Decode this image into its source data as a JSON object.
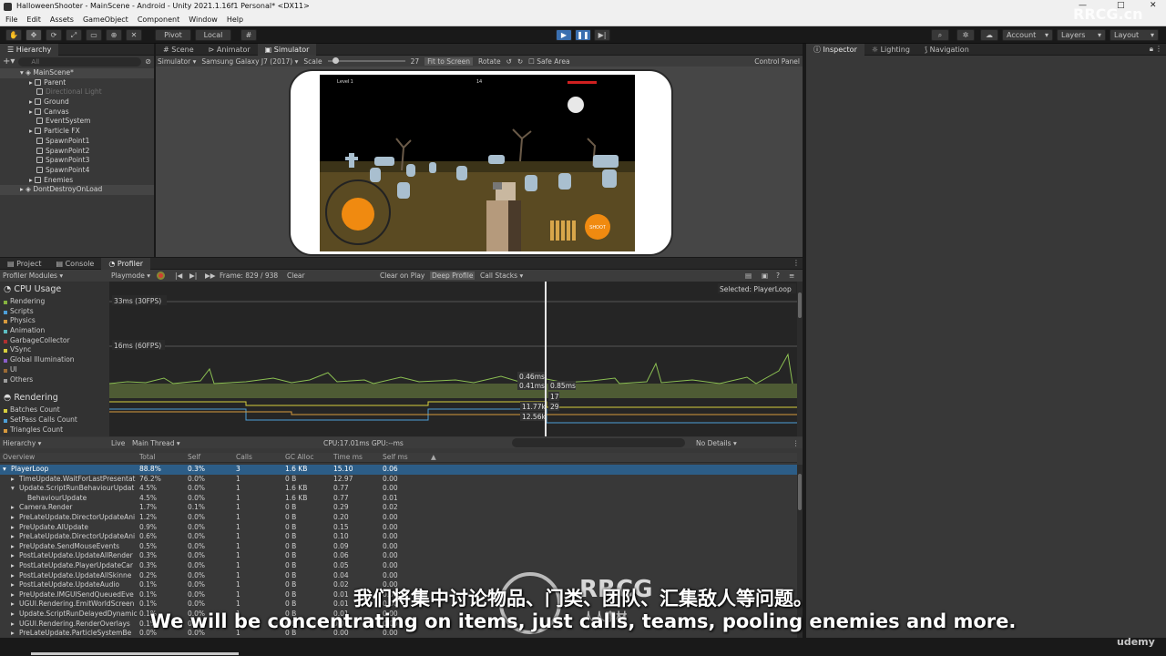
{
  "titlebar": {
    "title": "HalloweenShooter - MainScene - Android - Unity 2021.1.16f1 Personal* <DX11>",
    "minimize": "—",
    "maximize": "□",
    "close": "✕"
  },
  "menu": [
    "File",
    "Edit",
    "Assets",
    "GameObject",
    "Component",
    "Window",
    "Help"
  ],
  "toolbar": {
    "pivot": "Pivot",
    "local": "Local",
    "account": "Account",
    "layers": "Layers",
    "layout": "Layout"
  },
  "hierarchy": {
    "tab": "Hierarchy",
    "search_placeholder": "All",
    "scene": "MainScene*",
    "items": [
      {
        "label": "Parent",
        "dim": false,
        "arrow": true
      },
      {
        "label": "Directional Light",
        "dim": true,
        "arrow": false
      },
      {
        "label": "Ground",
        "dim": false,
        "arrow": true
      },
      {
        "label": "Canvas",
        "dim": false,
        "arrow": true
      },
      {
        "label": "EventSystem",
        "dim": false,
        "arrow": false
      },
      {
        "label": "Particle FX",
        "dim": false,
        "arrow": true
      },
      {
        "label": "SpawnPoint1",
        "dim": false,
        "arrow": false
      },
      {
        "label": "SpawnPoint2",
        "dim": false,
        "arrow": false
      },
      {
        "label": "SpawnPoint3",
        "dim": false,
        "arrow": false
      },
      {
        "label": "SpawnPoint4",
        "dim": false,
        "arrow": false
      },
      {
        "label": "Enemies",
        "dim": false,
        "arrow": true
      }
    ],
    "dontdestroy": "DontDestroyOnLoad"
  },
  "center_tabs": [
    "Scene",
    "Animator",
    "Simulator"
  ],
  "simulator": {
    "mode": "Simulator",
    "device": "Samsung Galaxy J7 (2017)",
    "scale_label": "Scale",
    "scale_value": "27",
    "scale_fraction": 0.1,
    "fit": "Fit to Screen",
    "rotate": "Rotate",
    "safe_area": "Safe Area",
    "control_panel": "Control Panel"
  },
  "game": {
    "level": "Level 1",
    "score": "14",
    "shoot": "SHOOT"
  },
  "right_tabs": [
    "Inspector",
    "Lighting",
    "Navigation"
  ],
  "bottom_tabs": [
    "Project",
    "Console",
    "Profiler"
  ],
  "profiler": {
    "modules_label": "Profiler Modules",
    "playmode": "Playmode",
    "frame": "Frame: 829 / 938",
    "clear": "Clear",
    "clear_on_play": "Clear on Play",
    "deep_profile": "Deep Profile",
    "call_stacks": "Call Stacks",
    "cpu_title": "CPU Usage",
    "cpu_items": [
      {
        "label": "Rendering",
        "color": "#86b33f"
      },
      {
        "label": "Scripts",
        "color": "#4d9fd8"
      },
      {
        "label": "Physics",
        "color": "#d89a3d"
      },
      {
        "label": "Animation",
        "color": "#5dbec2"
      },
      {
        "label": "GarbageCollector",
        "color": "#b03030"
      },
      {
        "label": "VSync",
        "color": "#d8cf3d"
      },
      {
        "label": "Global Illumination",
        "color": "#8a5ec9"
      },
      {
        "label": "UI",
        "color": "#9c6b35"
      },
      {
        "label": "Others",
        "color": "#9d9d9d"
      }
    ],
    "rendering_title": "Rendering",
    "rendering_items": [
      {
        "label": "Batches Count",
        "color": "#d8cf3d"
      },
      {
        "label": "SetPass Calls Count",
        "color": "#4d9fd8"
      },
      {
        "label": "Triangles Count",
        "color": "#d89a3d"
      }
    ],
    "graph_30": "33ms (30FPS)",
    "graph_60": "16ms (60FPS)",
    "selected": "Selected: PlayerLoop",
    "readouts": [
      "0.46ms",
      "0.41ms",
      "0.85ms",
      "17",
      "11.77k",
      "29",
      "12.56k"
    ],
    "view": "Hierarchy",
    "live": "Live",
    "thread": "Main Thread",
    "cpu_gpu": "CPU:17.01ms   GPU:--ms",
    "no_details": "No Details",
    "columns": [
      "Overview",
      "Total",
      "Self",
      "Calls",
      "GC Alloc",
      "Time ms",
      "Self ms"
    ],
    "rows": [
      {
        "name": "PlayerLoop",
        "total": "88.8%",
        "self": "0.3%",
        "calls": "3",
        "gc": "1.6 KB",
        "time": "15.10",
        "selfms": "0.06",
        "indent": 0,
        "sel": true
      },
      {
        "name": "TimeUpdate.WaitForLastPresentat",
        "total": "76.2%",
        "self": "0.0%",
        "calls": "1",
        "gc": "0 B",
        "time": "12.97",
        "selfms": "0.00",
        "indent": 1,
        "sel": false
      },
      {
        "name": "Update.ScriptRunBehaviourUpdat",
        "total": "4.5%",
        "self": "0.0%",
        "calls": "1",
        "gc": "1.6 KB",
        "time": "0.77",
        "selfms": "0.00",
        "indent": 1,
        "sel": false
      },
      {
        "name": "BehaviourUpdate",
        "total": "4.5%",
        "self": "0.0%",
        "calls": "1",
        "gc": "1.6 KB",
        "time": "0.77",
        "selfms": "0.01",
        "indent": 2,
        "sel": false
      },
      {
        "name": "Camera.Render",
        "total": "1.7%",
        "self": "0.1%",
        "calls": "1",
        "gc": "0 B",
        "time": "0.29",
        "selfms": "0.02",
        "indent": 1,
        "sel": false
      },
      {
        "name": "PreLateUpdate.DirectorUpdateAni",
        "total": "1.2%",
        "self": "0.0%",
        "calls": "1",
        "gc": "0 B",
        "time": "0.20",
        "selfms": "0.00",
        "indent": 1,
        "sel": false
      },
      {
        "name": "PreUpdate.AIUpdate",
        "total": "0.9%",
        "self": "0.0%",
        "calls": "1",
        "gc": "0 B",
        "time": "0.15",
        "selfms": "0.00",
        "indent": 1,
        "sel": false
      },
      {
        "name": "PreLateUpdate.DirectorUpdateAni",
        "total": "0.6%",
        "self": "0.0%",
        "calls": "1",
        "gc": "0 B",
        "time": "0.10",
        "selfms": "0.00",
        "indent": 1,
        "sel": false
      },
      {
        "name": "PreUpdate.SendMouseEvents",
        "total": "0.5%",
        "self": "0.0%",
        "calls": "1",
        "gc": "0 B",
        "time": "0.09",
        "selfms": "0.00",
        "indent": 1,
        "sel": false
      },
      {
        "name": "PostLateUpdate.UpdateAllRender",
        "total": "0.3%",
        "self": "0.0%",
        "calls": "1",
        "gc": "0 B",
        "time": "0.06",
        "selfms": "0.00",
        "indent": 1,
        "sel": false
      },
      {
        "name": "PostLateUpdate.PlayerUpdateCar",
        "total": "0.3%",
        "self": "0.0%",
        "calls": "1",
        "gc": "0 B",
        "time": "0.05",
        "selfms": "0.00",
        "indent": 1,
        "sel": false
      },
      {
        "name": "PostLateUpdate.UpdateAllSkinne",
        "total": "0.2%",
        "self": "0.0%",
        "calls": "1",
        "gc": "0 B",
        "time": "0.04",
        "selfms": "0.00",
        "indent": 1,
        "sel": false
      },
      {
        "name": "PostLateUpdate.UpdateAudio",
        "total": "0.1%",
        "self": "0.0%",
        "calls": "1",
        "gc": "0 B",
        "time": "0.02",
        "selfms": "0.00",
        "indent": 1,
        "sel": false
      },
      {
        "name": "PreUpdate.IMGUISendQueuedEve",
        "total": "0.1%",
        "self": "0.0%",
        "calls": "1",
        "gc": "0 B",
        "time": "0.01",
        "selfms": "0.00",
        "indent": 1,
        "sel": false
      },
      {
        "name": "UGUI.Rendering.EmitWorldScreen",
        "total": "0.1%",
        "self": "0.0%",
        "calls": "1",
        "gc": "0 B",
        "time": "0.01",
        "selfms": "0.00",
        "indent": 1,
        "sel": false
      },
      {
        "name": "Update.ScriptRunDelayedDynamic",
        "total": "0.1%",
        "self": "0.0%",
        "calls": "1",
        "gc": "0 B",
        "time": "0.01",
        "selfms": "0.00",
        "indent": 1,
        "sel": false
      },
      {
        "name": "UGUI.Rendering.RenderOverlays",
        "total": "0.1%",
        "self": "0.0%",
        "calls": "1",
        "gc": "0 B",
        "time": "0.01",
        "selfms": "0.00",
        "indent": 1,
        "sel": false
      },
      {
        "name": "PreLateUpdate.ParticleSystemBe",
        "total": "0.0%",
        "self": "0.0%",
        "calls": "1",
        "gc": "0 B",
        "time": "0.00",
        "selfms": "0.00",
        "indent": 1,
        "sel": false
      }
    ]
  },
  "subtitles": {
    "cn": "我们将集中讨论物品、门类、团队、汇集敌人等问题。",
    "en": "We will be concentrating on items, just calls, teams, pooling enemies and more."
  },
  "watermarks": {
    "corner": "RRCG.cn",
    "logo": "RRCG",
    "logo_sub": "人人素材",
    "udemy": "udemy"
  }
}
